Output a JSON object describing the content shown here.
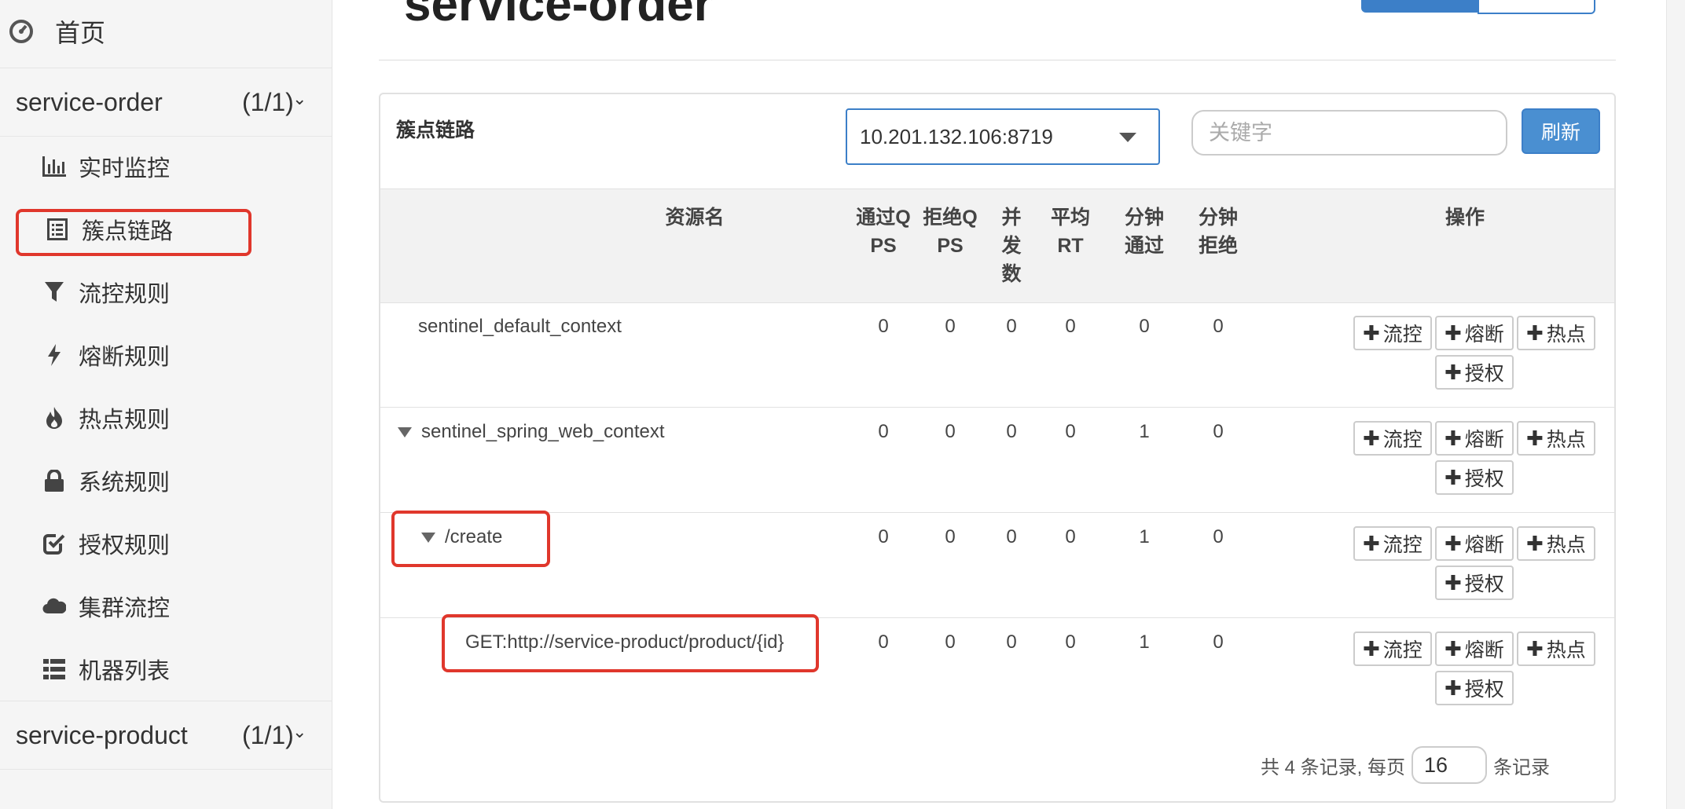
{
  "sidebar": {
    "home_label": "首页",
    "apps": [
      {
        "name": "service-order",
        "count": "(1/1)"
      },
      {
        "name": "service-product",
        "count": "(1/1)"
      }
    ],
    "items": [
      {
        "label": "实时监控",
        "icon": "bar-chart-icon"
      },
      {
        "label": "簇点链路",
        "icon": "list-alt-icon"
      },
      {
        "label": "流控规则",
        "icon": "filter-icon"
      },
      {
        "label": "熔断规则",
        "icon": "flash-icon"
      },
      {
        "label": "热点规则",
        "icon": "fire-icon"
      },
      {
        "label": "系统规则",
        "icon": "lock-icon"
      },
      {
        "label": "授权规则",
        "icon": "check-icon"
      },
      {
        "label": "集群流控",
        "icon": "cloud-icon"
      },
      {
        "label": "机器列表",
        "icon": "th-list-icon"
      }
    ]
  },
  "main": {
    "page_title": "service-order",
    "panel_title": "簇点链路",
    "machine_select": "10.201.132.106:8719",
    "keyword_placeholder": "关键字",
    "refresh_label": "刷新"
  },
  "table": {
    "headers": {
      "resource": "资源名",
      "pass_qps": [
        "通过Q",
        "PS"
      ],
      "block_qps": [
        "拒绝Q",
        "PS"
      ],
      "concurrency": [
        "并",
        "发",
        "数"
      ],
      "avg_rt": [
        "平均",
        "RT"
      ],
      "minute_pass": [
        "分钟",
        "通过"
      ],
      "minute_block": [
        "分钟",
        "拒绝"
      ],
      "ops": "操作"
    },
    "rows": [
      {
        "name": "sentinel_default_context",
        "pass_qps": "0",
        "block_qps": "0",
        "concurrency": "0",
        "avg_rt": "0",
        "minute_pass": "0",
        "minute_block": "0"
      },
      {
        "name": "sentinel_spring_web_context",
        "pass_qps": "0",
        "block_qps": "0",
        "concurrency": "0",
        "avg_rt": "0",
        "minute_pass": "1",
        "minute_block": "0"
      },
      {
        "name": "/create",
        "pass_qps": "0",
        "block_qps": "0",
        "concurrency": "0",
        "avg_rt": "0",
        "minute_pass": "1",
        "minute_block": "0"
      },
      {
        "name": "GET:http://service-product/product/{id}",
        "pass_qps": "0",
        "block_qps": "0",
        "concurrency": "0",
        "avg_rt": "0",
        "minute_pass": "1",
        "minute_block": "0"
      }
    ],
    "op_buttons": {
      "plus": "✚",
      "flow": "流控",
      "degrade": "熔断",
      "hotspot": "热点",
      "auth": "授权"
    }
  },
  "pager": {
    "prefix": "共 4 条记录, 每页",
    "page_size": "16",
    "suffix": "条记录"
  },
  "colors": {
    "accent": "#3c7fc8",
    "highlight": "#e0372c"
  }
}
